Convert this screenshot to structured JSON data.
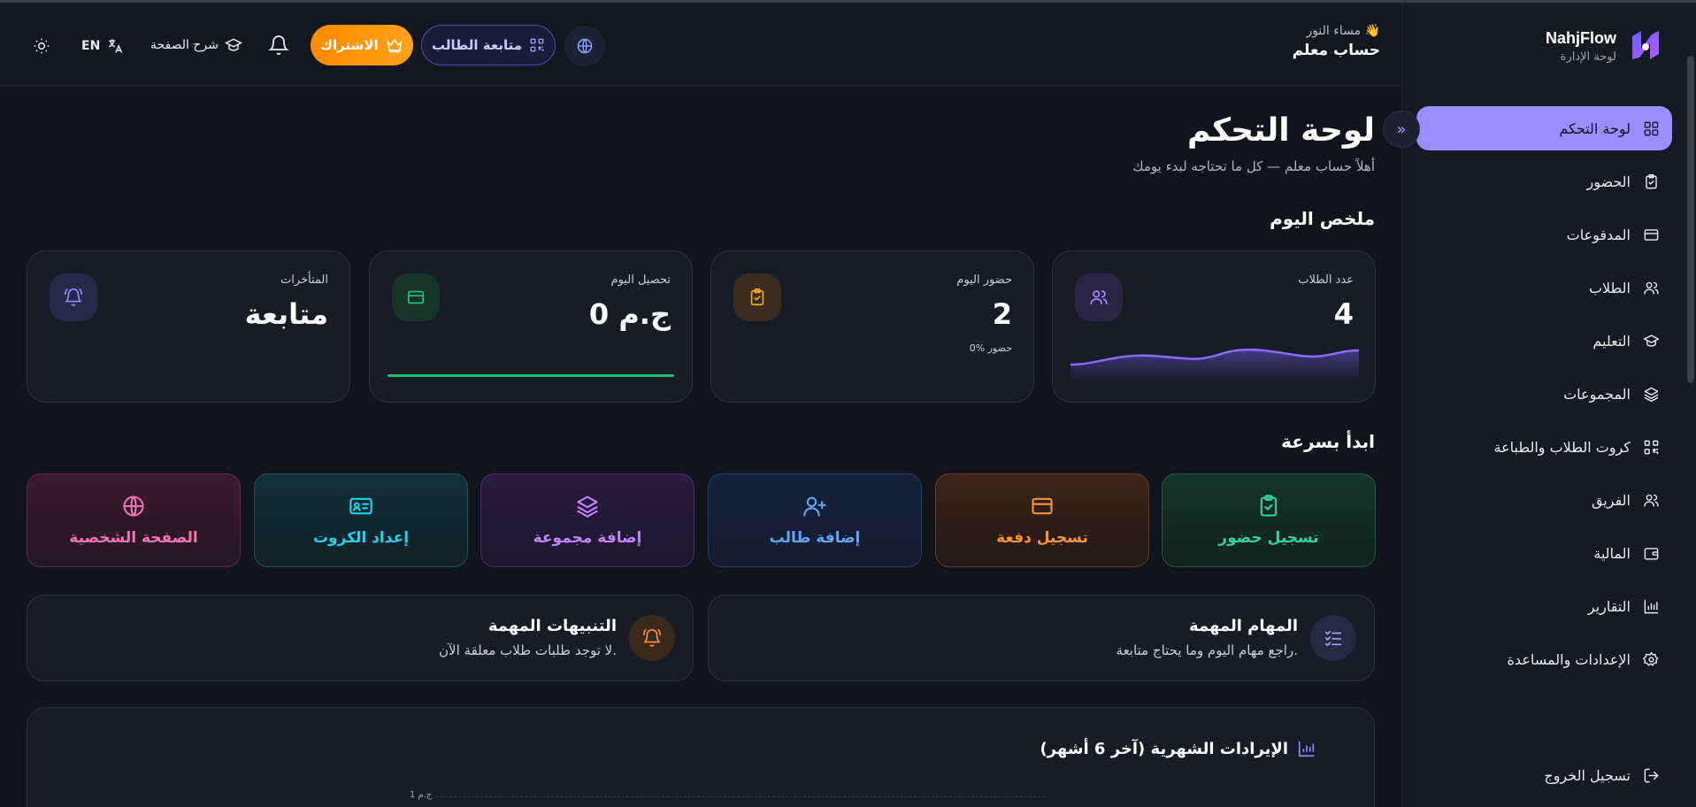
{
  "brand": {
    "name": "NahjFlow",
    "subtitle": "لوحة الإدارة"
  },
  "sidebar": {
    "items": [
      {
        "label": "لوحة التحكم",
        "icon": "dashboard-icon",
        "active": true
      },
      {
        "label": "الحضور",
        "icon": "clipboard-check-icon"
      },
      {
        "label": "المدفوعات",
        "icon": "credit-card-icon"
      },
      {
        "label": "الطلاب",
        "icon": "users-icon"
      },
      {
        "label": "التعليم",
        "icon": "graduation-cap-icon"
      },
      {
        "label": "المجموعات",
        "icon": "layers-icon"
      },
      {
        "label": "كروت الطلاب والطباعة",
        "icon": "qr-code-icon"
      },
      {
        "label": "الفريق",
        "icon": "users-icon"
      },
      {
        "label": "المالية",
        "icon": "wallet-icon"
      },
      {
        "label": "التقارير",
        "icon": "bar-chart-icon"
      },
      {
        "label": "الإعدادات والمساعدة",
        "icon": "gear-icon"
      }
    ],
    "logout": "تسجيل الخروج",
    "active_color": "#9b8cff"
  },
  "header": {
    "greeting": "مساء النور 👋",
    "account": "حساب معلم",
    "track_student": "متابعة الطالب",
    "subscribe": "الاشتراك",
    "page_help": "شرح الصفحة",
    "language": "EN",
    "subscribe_color": "#ff8a00"
  },
  "main": {
    "title": "لوحة التحكم",
    "subtitle": "أهلاً حساب معلم — كل ما تحتاجه لبدء يومك",
    "summary_title": "ملخص اليوم",
    "stats": [
      {
        "label": "عدد الطلاب",
        "value": "4",
        "icon": "users-icon",
        "color": "#a78bfa"
      },
      {
        "label": "حضور اليوم",
        "value": "2",
        "note": "0% حضور",
        "icon": "clipboard-check-icon",
        "color": "#f5a524"
      },
      {
        "label": "تحصيل اليوم",
        "value": "0 ج.م",
        "icon": "credit-card-icon",
        "color": "#22c57f"
      },
      {
        "label": "المتأخرات",
        "value": "متابعة",
        "icon": "bell-ring-icon",
        "color": "#8b8cff"
      }
    ],
    "quick_title": "ابدأ بسرعة",
    "quick_actions": [
      {
        "label": "تسجيل حضور",
        "icon": "clipboard-check-icon",
        "color": "#34d399"
      },
      {
        "label": "تسجيل دفعة",
        "icon": "credit-card-icon",
        "color": "#fb923c"
      },
      {
        "label": "إضافة طالب",
        "icon": "user-plus-icon",
        "color": "#60a5fa"
      },
      {
        "label": "إضافة مجموعة",
        "icon": "layers-icon",
        "color": "#c084fc"
      },
      {
        "label": "إعداد الكروت",
        "icon": "id-card-icon",
        "color": "#22d3ee"
      },
      {
        "label": "الصفحة الشخصية",
        "icon": "globe-icon",
        "color": "#f472b6"
      }
    ],
    "tasks": {
      "title": "المهام المهمة",
      "subtitle": "راجع مهام اليوم وما يحتاج متابعة."
    },
    "alerts": {
      "title": "التنبيهات المهمة",
      "subtitle": "لا توجد طلبات طلاب معلقة الآن."
    },
    "revenue": {
      "title": "الإيرادات الشهرية (آخر 6 أشهر)",
      "y_tick": "1 ج.م"
    }
  }
}
